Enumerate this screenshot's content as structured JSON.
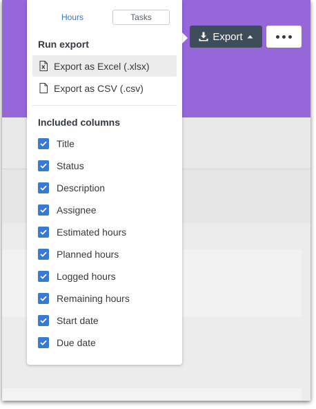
{
  "header": {
    "export_label": "Export",
    "icons": {
      "export": "download-icon",
      "caret": "caret-up-icon",
      "more": "more-horizontal-icon"
    }
  },
  "popup": {
    "tabs": [
      {
        "label": "Hours",
        "selected": true
      },
      {
        "label": "Tasks",
        "selected": false
      }
    ],
    "run_export": {
      "title": "Run export",
      "items": [
        {
          "label": "Export as Excel (.xlsx)",
          "icon": "excel-file-icon",
          "highlighted": true
        },
        {
          "label": "Export as CSV (.csv)",
          "icon": "file-icon",
          "highlighted": false
        }
      ]
    },
    "included_columns": {
      "title": "Included columns",
      "items": [
        {
          "label": "Title",
          "checked": true
        },
        {
          "label": "Status",
          "checked": true
        },
        {
          "label": "Description",
          "checked": true
        },
        {
          "label": "Assignee",
          "checked": true
        },
        {
          "label": "Estimated hours",
          "checked": true
        },
        {
          "label": "Planned hours",
          "checked": true
        },
        {
          "label": "Logged hours",
          "checked": true
        },
        {
          "label": "Remaining hours",
          "checked": true
        },
        {
          "label": "Start date",
          "checked": true
        },
        {
          "label": "Due date",
          "checked": true
        }
      ]
    }
  },
  "colors": {
    "header_bg": "#9567d9",
    "export_button_bg": "#3d4d5a",
    "checkbox_bg": "#3a78d3",
    "tab_active_text": "#3c74c9"
  }
}
